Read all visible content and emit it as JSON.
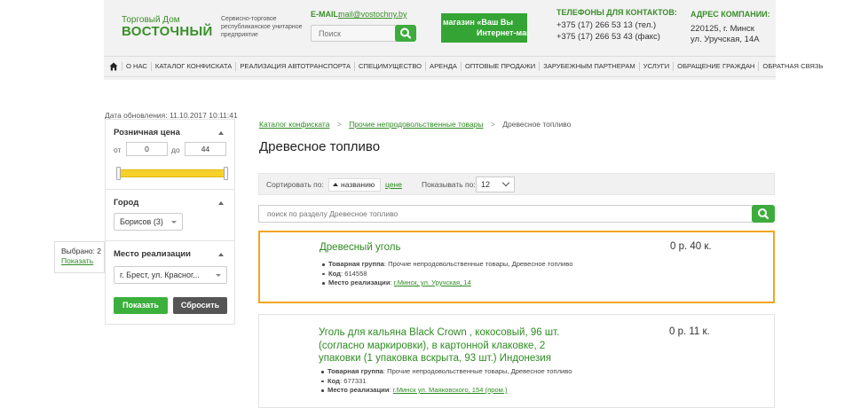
{
  "header": {
    "logo_top": "Торговый Дом",
    "logo_main": "ВОСТОЧНЫЙ",
    "logo_desc": "Сервисно-торговое республиканское унитарное предприятие",
    "email_label": "E-MAIL:",
    "email": "mail@vostochny.by",
    "search_placeholder": "Поиск",
    "banner_line1": "магазин «Ваш Вы",
    "banner_line2": "Интернет-маг",
    "phones_label": "ТЕЛЕФОНЫ ДЛЯ КОНТАКТОВ:",
    "phone1": "+375 (17) 266 53 13 (тел.)",
    "phone2": "+375 (17) 266 53 43 (факс)",
    "address_label": "АДРЕС КОМПАНИИ:",
    "address_line1": "220125, г. Минск",
    "address_line2": "ул. Уручская, 14А"
  },
  "nav": {
    "items": [
      "О НАС",
      "КАТАЛОГ КОНФИСКАТА",
      "РЕАЛИЗАЦИЯ АВТОТРАНСПОРТА",
      "СПЕЦИМУЩЕСТВО",
      "АРЕНДА",
      "ОПТОВЫЕ ПРОДАЖИ",
      "ЗАРУБЕЖНЫМ ПАРТНЕРАМ",
      "УСЛУГИ",
      "ОБРАЩЕНИЕ ГРАЖДАН",
      "ОБРАТНАЯ СВЯЗЬ"
    ]
  },
  "sidebar": {
    "update_date": "Дата обновления: 11.10.2017 10:11:41",
    "price_title": "Розничная цена",
    "from_label": "от",
    "from_value": "0",
    "to_label": "до",
    "to_value": "44",
    "slider_from": 0,
    "slider_to": 1,
    "city_title": "Город",
    "city_value": "Борисов (3)",
    "place_title": "Место реализации",
    "place_value": "г. Брест, ул. Красног...",
    "show_button": "Показать",
    "reset_button": "Сбросить",
    "popup_selected": "Выбрано: 2",
    "popup_show": "Показать"
  },
  "main": {
    "breadcrumb": [
      "Каталог конфиската",
      "Прочие непродовольственные товары",
      "Древесное топливо"
    ],
    "title": "Древесное топливо",
    "sort_label": "Сортировать по:",
    "sort_active": "названию",
    "sort_price": "цене",
    "per_page_label": "Показывать по:",
    "per_page_value": "12",
    "search_placeholder": "поиск по разделу Древесное топливо"
  },
  "products": [
    {
      "title": "Древесный уголь",
      "price": "0 р. 40 к.",
      "group_label": "Товарная группа",
      "group_value": ": Прочие непродовольственные товары, Древесное топливо",
      "code_label": "Код",
      "code_value": ": 614558",
      "place_label": "Место реализации",
      "place_sep": ": ",
      "place_value": "г.Минск, ул. Уручская, 14"
    },
    {
      "title_lines": [
        "Уголь для кальяна Black Crown , кокосовый, 96 шт.",
        "(согласно маркировки), в картонной клаковке, 2",
        "упаковки (1 упаковка вскрыта, 93 шт.) Индонезия"
      ],
      "price": "0 р. 11 к.",
      "group_label": "Товарная группа",
      "group_value": ": Прочие непродовольственные товары, Древесное топливо",
      "code_label": "Код",
      "code_value": ": 677331",
      "place_label": "Место реализации",
      "place_sep": ": ",
      "place_value": "г.Минск ул. Маяковского, 154 (пром.)"
    }
  ],
  "colors": {
    "brand_green": "#3a8f2a",
    "button_green": "#3cb03c",
    "highlight_border": "#f2a51e",
    "slider_fill": "#f7d12b"
  }
}
